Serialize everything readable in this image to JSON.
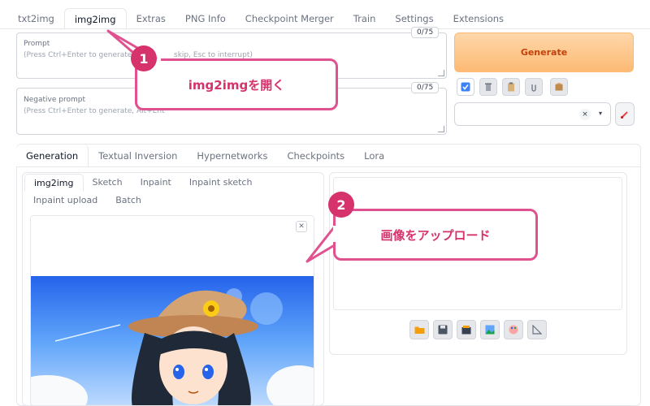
{
  "top_tabs": [
    "txt2img",
    "img2img",
    "Extras",
    "PNG Info",
    "Checkpoint Merger",
    "Train",
    "Settings",
    "Extensions"
  ],
  "prompt": {
    "label": "Prompt",
    "hint_visible_left": "(Press Ctrl+Enter to generate, Al",
    "hint_visible_right": "skip, Esc to interrupt)",
    "counter": "0/75"
  },
  "negative_prompt": {
    "label": "Negative prompt",
    "hint": "(Press Ctrl+Enter to generate, Alt+Ent",
    "counter": "0/75"
  },
  "generate_label": "Generate",
  "style_select": {
    "clear": "×",
    "caret": "▾"
  },
  "tool_icons": [
    "check-square-icon",
    "trash-icon",
    "clipboard-icon",
    "paperclip-icon",
    "package-icon"
  ],
  "sub_tabs": [
    "Generation",
    "Textual Inversion",
    "Hypernetworks",
    "Checkpoints",
    "Lora"
  ],
  "mode_tabs": [
    "img2img",
    "Sketch",
    "Inpaint",
    "Inpaint sketch",
    "Inpaint upload",
    "Batch"
  ],
  "output_icons": [
    "folder-icon",
    "save-icon",
    "zip-icon",
    "image-icon",
    "palette-icon",
    "ruler-icon"
  ],
  "callouts": {
    "step1": {
      "number": "1",
      "text": "img2imgを開く"
    },
    "step2": {
      "number": "2",
      "text": "画像をアップロード"
    }
  },
  "colors": {
    "accent": "#d6336c",
    "generate": "#fdba74"
  }
}
